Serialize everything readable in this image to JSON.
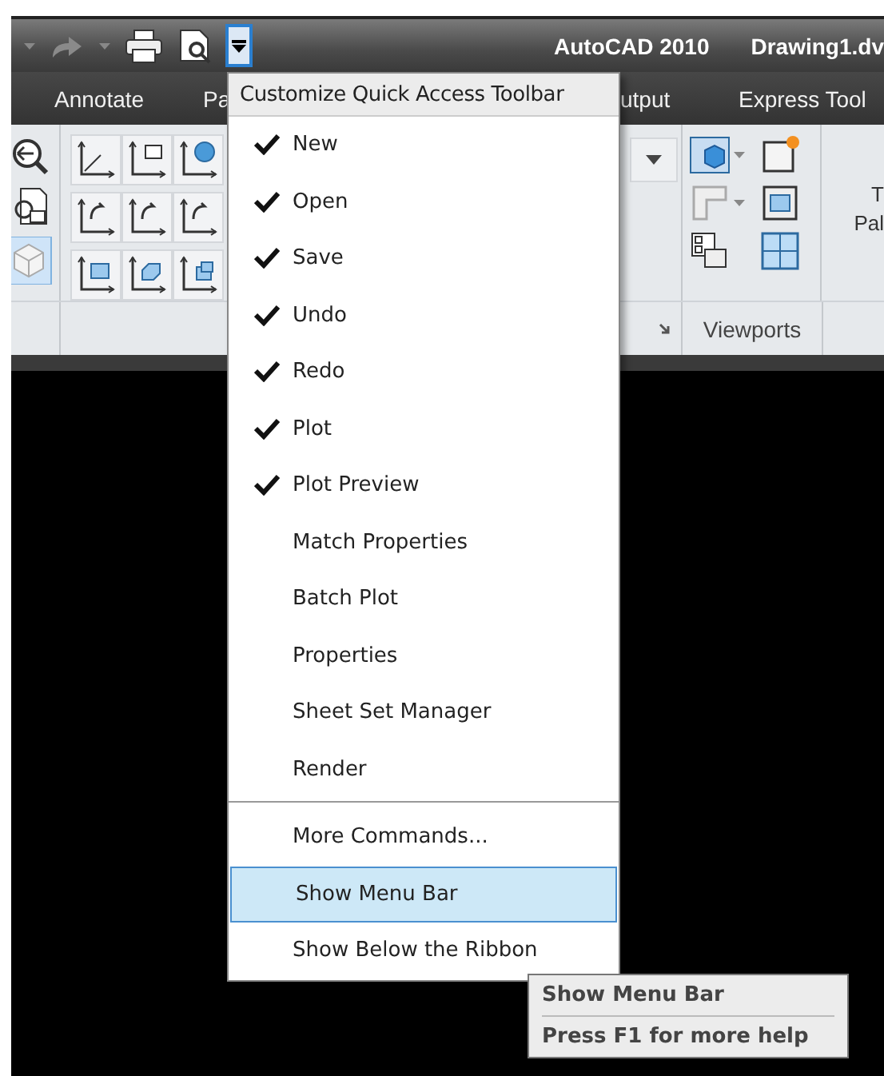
{
  "title_bar": {
    "app_title": "AutoCAD 2010",
    "document_title": "Drawing1.dv"
  },
  "ribbon_tabs": [
    {
      "label": "Annotate"
    },
    {
      "label": "Pa"
    },
    {
      "label": "utput"
    },
    {
      "label": "Express Tool"
    }
  ],
  "ribbon": {
    "panel_label": "Viewports",
    "cut_texts": [
      "T",
      "Pal"
    ]
  },
  "menu": {
    "title": "Customize Quick Access Toolbar",
    "items": [
      {
        "label": "New",
        "checked": true,
        "selected": false
      },
      {
        "label": "Open",
        "checked": true,
        "selected": false
      },
      {
        "label": "Save",
        "checked": true,
        "selected": false
      },
      {
        "label": "Undo",
        "checked": true,
        "selected": false
      },
      {
        "label": "Redo",
        "checked": true,
        "selected": false
      },
      {
        "label": "Plot",
        "checked": true,
        "selected": false
      },
      {
        "label": "Plot Preview",
        "checked": true,
        "selected": false
      },
      {
        "label": "Match Properties",
        "checked": false,
        "selected": false
      },
      {
        "label": "Batch Plot",
        "checked": false,
        "selected": false
      },
      {
        "label": "Properties",
        "checked": false,
        "selected": false
      },
      {
        "label": "Sheet Set Manager",
        "checked": false,
        "selected": false
      },
      {
        "label": "Render",
        "checked": false,
        "selected": false
      }
    ],
    "extra_items": [
      {
        "label": "More Commands...",
        "selected": false
      },
      {
        "label": "Show Menu Bar",
        "selected": true
      },
      {
        "label": "Show Below the Ribbon",
        "selected": false
      }
    ]
  },
  "tooltip": {
    "title": "Show Menu Bar",
    "help": "Press F1 for more help"
  }
}
